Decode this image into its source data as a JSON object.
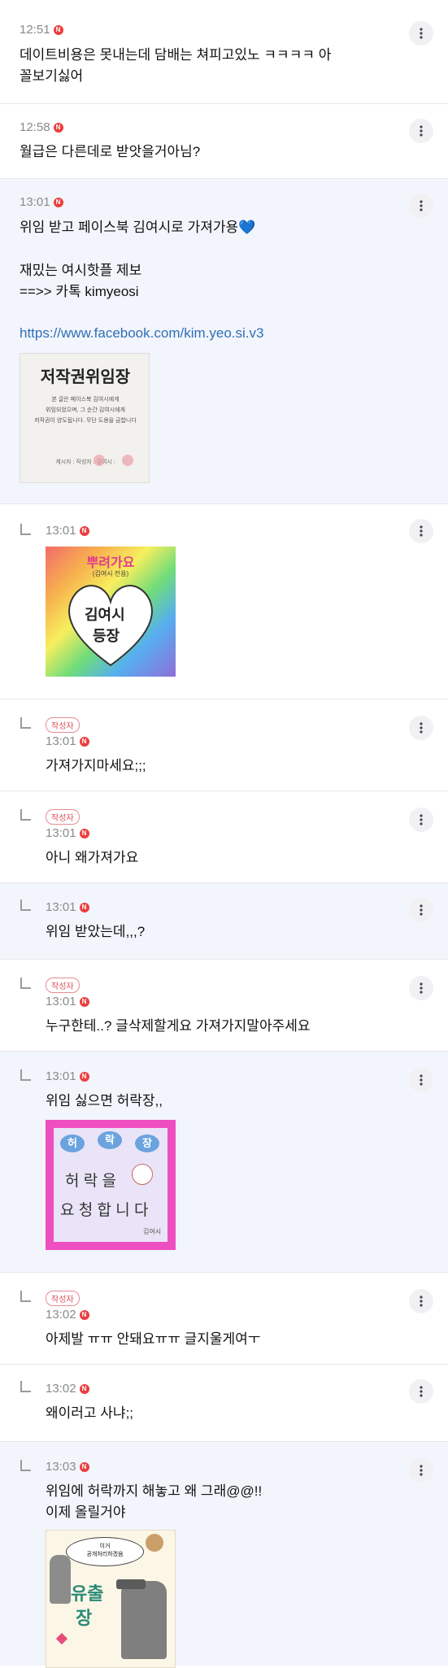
{
  "comments": [
    {
      "time": "12:51",
      "text": "데이트비용은 못내는데 담배는 쳐피고있노 ㅋㅋㅋㅋ 아\n꼴보기싫어"
    },
    {
      "time": "12:58",
      "text": "월급은 다른데로 받앗을거아님?"
    },
    {
      "time": "13:01",
      "line1": "위임 받고 페이스북 김여시로 가져가용",
      "heart": "💙",
      "line2": "재밌는 여시핫플 제보",
      "line3": "==>> 카톡 kimyeosi",
      "link": "https://www.facebook.com/kim.yeo.si.v3",
      "image": {
        "title": "저작권위임장",
        "line1": "본 글은 페이스북 김여시에게",
        "line2": "위임되었으며, 그 순간 김여시에게",
        "line3": "저작권이 양도됩니다. 무단 도용을 금합니다",
        "sign": "게시자 :    작성자 :    김여시 :"
      }
    },
    {
      "time": "13:01",
      "image": {
        "top": "뿌려가요",
        "sub": "(김여시 전용)",
        "l1": "김여시",
        "l2": "등장"
      }
    },
    {
      "badge": "작성자",
      "time": "13:01",
      "text": "가져가지마세요;;;"
    },
    {
      "badge": "작성자",
      "time": "13:01",
      "text": "아니 왜가져가요"
    },
    {
      "time": "13:01",
      "text": "위임 받았는데,,,?"
    },
    {
      "badge": "작성자",
      "time": "13:01",
      "text": "누구한테..? 글삭제할게요 가져가지말아주세요"
    },
    {
      "time": "13:01",
      "text": "위임 싫으면 허락장,,",
      "image": {
        "c1": "허",
        "c2": "락",
        "c3": "장",
        "l1": "허 락 을",
        "l2": "요 청 합 니 다",
        "sign": "김여시"
      }
    },
    {
      "badge": "작성자",
      "time": "13:02",
      "text": "아제발 ㅠㅠ 안돼요ㅠㅠ 글지울게여ㅜ"
    },
    {
      "time": "13:02",
      "text": "왜이러고 사냐;;"
    },
    {
      "time": "13:03",
      "text": "위임에 허락까지 해놓고 왜 그래@@!!",
      "text2": "이제 올릴거야",
      "image": {
        "bubble": "이거\n공개처리하겠음",
        "l1": "유출",
        "l2": "장"
      }
    }
  ],
  "icons": {
    "more": "more-vertical-icon",
    "new": "new-badge-icon",
    "reply": "reply-arrow-icon"
  },
  "colors": {
    "highlight": "#f2f5fb",
    "badge": "#e0505a",
    "link": "#2f6fb6",
    "new": "#ec3d3d"
  }
}
